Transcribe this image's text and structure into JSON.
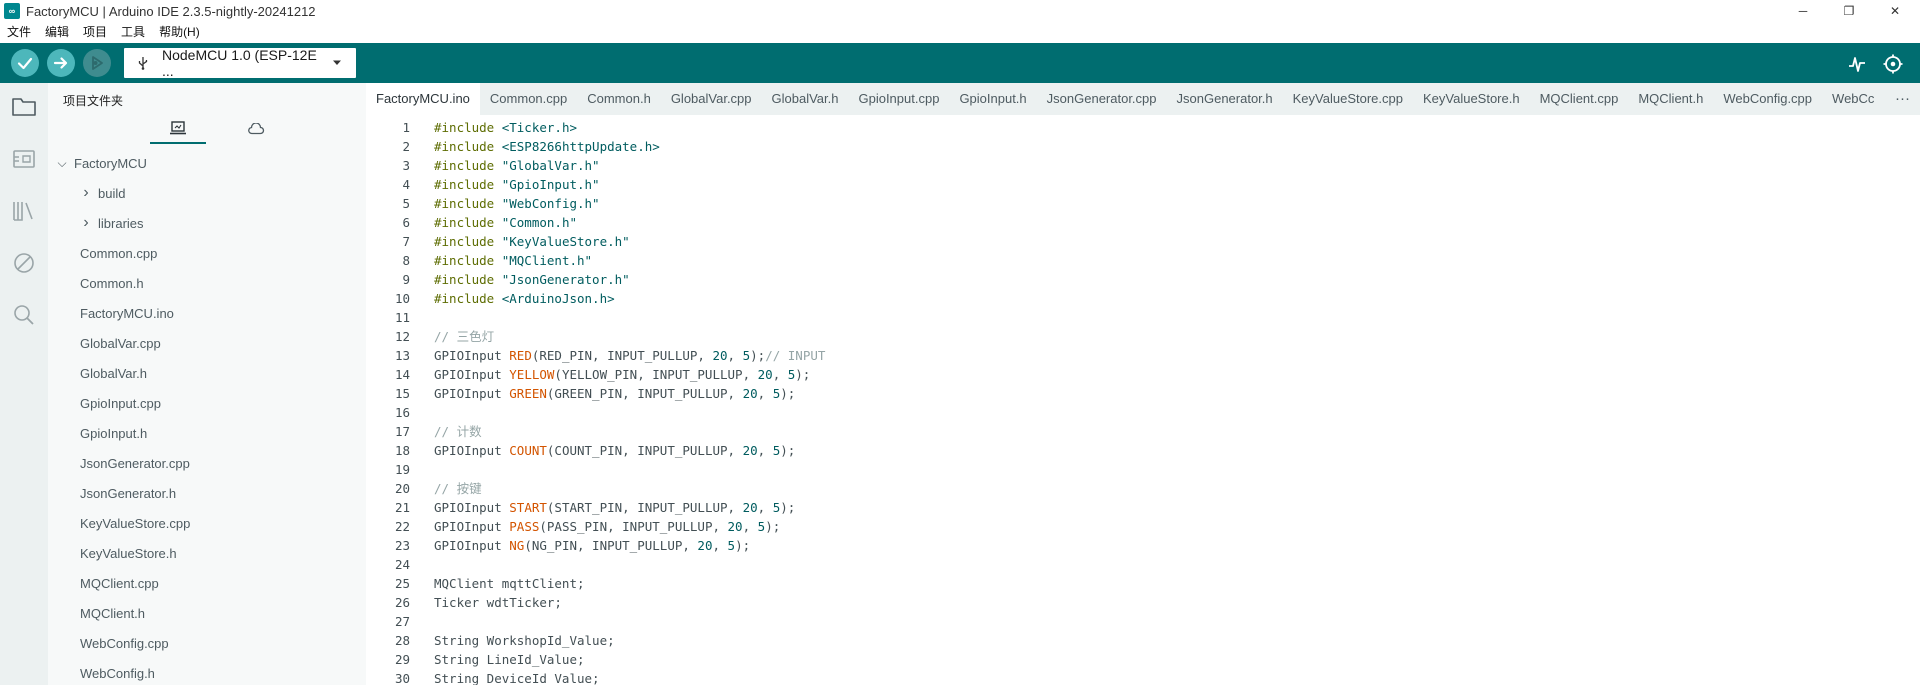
{
  "window": {
    "title": "FactoryMCU | Arduino IDE 2.3.5-nightly-20241212",
    "logo_text": "∞",
    "minimize": "─",
    "restore": "❐",
    "close": "✕"
  },
  "menu": [
    "文件",
    "编辑",
    "项目",
    "工具",
    "帮助(H)"
  ],
  "toolbar": {
    "board": "NodeMCU 1.0 (ESP-12E ...",
    "colors": {
      "bar": "#006d70",
      "button": "#4db7bb"
    }
  },
  "sidebar": {
    "title": "项目文件夹",
    "root": "FactoryMCU",
    "items": [
      {
        "type": "folder",
        "label": "build"
      },
      {
        "type": "folder",
        "label": "libraries"
      },
      {
        "type": "file",
        "label": "Common.cpp"
      },
      {
        "type": "file",
        "label": "Common.h"
      },
      {
        "type": "file",
        "label": "FactoryMCU.ino"
      },
      {
        "type": "file",
        "label": "GlobalVar.cpp"
      },
      {
        "type": "file",
        "label": "GlobalVar.h"
      },
      {
        "type": "file",
        "label": "GpioInput.cpp"
      },
      {
        "type": "file",
        "label": "GpioInput.h"
      },
      {
        "type": "file",
        "label": "JsonGenerator.cpp"
      },
      {
        "type": "file",
        "label": "JsonGenerator.h"
      },
      {
        "type": "file",
        "label": "KeyValueStore.cpp"
      },
      {
        "type": "file",
        "label": "KeyValueStore.h"
      },
      {
        "type": "file",
        "label": "MQClient.cpp"
      },
      {
        "type": "file",
        "label": "MQClient.h"
      },
      {
        "type": "file",
        "label": "WebConfig.cpp"
      },
      {
        "type": "file",
        "label": "WebConfig.h"
      }
    ]
  },
  "tabs": [
    {
      "label": "FactoryMCU.ino",
      "active": true
    },
    {
      "label": "Common.cpp"
    },
    {
      "label": "Common.h"
    },
    {
      "label": "GlobalVar.cpp"
    },
    {
      "label": "GlobalVar.h"
    },
    {
      "label": "GpioInput.cpp"
    },
    {
      "label": "GpioInput.h"
    },
    {
      "label": "JsonGenerator.cpp"
    },
    {
      "label": "JsonGenerator.h"
    },
    {
      "label": "KeyValueStore.cpp"
    },
    {
      "label": "KeyValueStore.h"
    },
    {
      "label": "MQClient.cpp"
    },
    {
      "label": "MQClient.h"
    },
    {
      "label": "WebConfig.cpp"
    },
    {
      "label": "WebCc"
    }
  ],
  "tabs_more": "···",
  "editor": {
    "lines": [
      [
        [
          "pp",
          "#include "
        ],
        [
          "str",
          "<Ticker.h>"
        ]
      ],
      [
        [
          "pp",
          "#include "
        ],
        [
          "str",
          "<ESP8266httpUpdate.h>"
        ]
      ],
      [
        [
          "pp",
          "#include "
        ],
        [
          "str",
          "\"GlobalVar.h\""
        ]
      ],
      [
        [
          "pp",
          "#include "
        ],
        [
          "str",
          "\"GpioInput.h\""
        ]
      ],
      [
        [
          "pp",
          "#include "
        ],
        [
          "str",
          "\"WebConfig.h\""
        ]
      ],
      [
        [
          "pp",
          "#include "
        ],
        [
          "str",
          "\"Common.h\""
        ]
      ],
      [
        [
          "pp",
          "#include "
        ],
        [
          "str",
          "\"KeyValueStore.h\""
        ]
      ],
      [
        [
          "pp",
          "#include "
        ],
        [
          "str",
          "\"MQClient.h\""
        ]
      ],
      [
        [
          "pp",
          "#include "
        ],
        [
          "str",
          "\"JsonGenerator.h\""
        ]
      ],
      [
        [
          "pp",
          "#include "
        ],
        [
          "str",
          "<ArduinoJson.h>"
        ]
      ],
      [],
      [
        [
          "cm",
          "// 三色灯"
        ]
      ],
      [
        [
          "n",
          "GPIOInput "
        ],
        [
          "fn",
          "RED"
        ],
        [
          "n",
          "(RED_PIN, INPUT_PULLUP, "
        ],
        [
          "num",
          "20"
        ],
        [
          "n",
          ", "
        ],
        [
          "num",
          "5"
        ],
        [
          "n",
          ");"
        ],
        [
          "cm",
          "// INPUT"
        ]
      ],
      [
        [
          "n",
          "GPIOInput "
        ],
        [
          "fn",
          "YELLOW"
        ],
        [
          "n",
          "(YELLOW_PIN, INPUT_PULLUP, "
        ],
        [
          "num",
          "20"
        ],
        [
          "n",
          ", "
        ],
        [
          "num",
          "5"
        ],
        [
          "n",
          ");"
        ]
      ],
      [
        [
          "n",
          "GPIOInput "
        ],
        [
          "fn",
          "GREEN"
        ],
        [
          "n",
          "(GREEN_PIN, INPUT_PULLUP, "
        ],
        [
          "num",
          "20"
        ],
        [
          "n",
          ", "
        ],
        [
          "num",
          "5"
        ],
        [
          "n",
          ");"
        ]
      ],
      [],
      [
        [
          "cm",
          "// 计数"
        ]
      ],
      [
        [
          "n",
          "GPIOInput "
        ],
        [
          "fn",
          "COUNT"
        ],
        [
          "n",
          "(COUNT_PIN, INPUT_PULLUP, "
        ],
        [
          "num",
          "20"
        ],
        [
          "n",
          ", "
        ],
        [
          "num",
          "5"
        ],
        [
          "n",
          ");"
        ]
      ],
      [],
      [
        [
          "cm",
          "// 按键"
        ]
      ],
      [
        [
          "n",
          "GPIOInput "
        ],
        [
          "fn",
          "START"
        ],
        [
          "n",
          "(START_PIN, INPUT_PULLUP, "
        ],
        [
          "num",
          "20"
        ],
        [
          "n",
          ", "
        ],
        [
          "num",
          "5"
        ],
        [
          "n",
          ");"
        ]
      ],
      [
        [
          "n",
          "GPIOInput "
        ],
        [
          "fn",
          "PASS"
        ],
        [
          "n",
          "(PASS_PIN, INPUT_PULLUP, "
        ],
        [
          "num",
          "20"
        ],
        [
          "n",
          ", "
        ],
        [
          "num",
          "5"
        ],
        [
          "n",
          ");"
        ]
      ],
      [
        [
          "n",
          "GPIOInput "
        ],
        [
          "fn",
          "NG"
        ],
        [
          "n",
          "(NG_PIN, INPUT_PULLUP, "
        ],
        [
          "num",
          "20"
        ],
        [
          "n",
          ", "
        ],
        [
          "num",
          "5"
        ],
        [
          "n",
          ");"
        ]
      ],
      [],
      [
        [
          "n",
          "MQClient mqttClient;"
        ]
      ],
      [
        [
          "n",
          "Ticker wdtTicker;"
        ]
      ],
      [],
      [
        [
          "n",
          "String WorkshopId_Value;"
        ]
      ],
      [
        [
          "n",
          "String LineId_Value;"
        ]
      ],
      [
        [
          "n",
          "String DeviceId_Value;"
        ]
      ]
    ]
  }
}
